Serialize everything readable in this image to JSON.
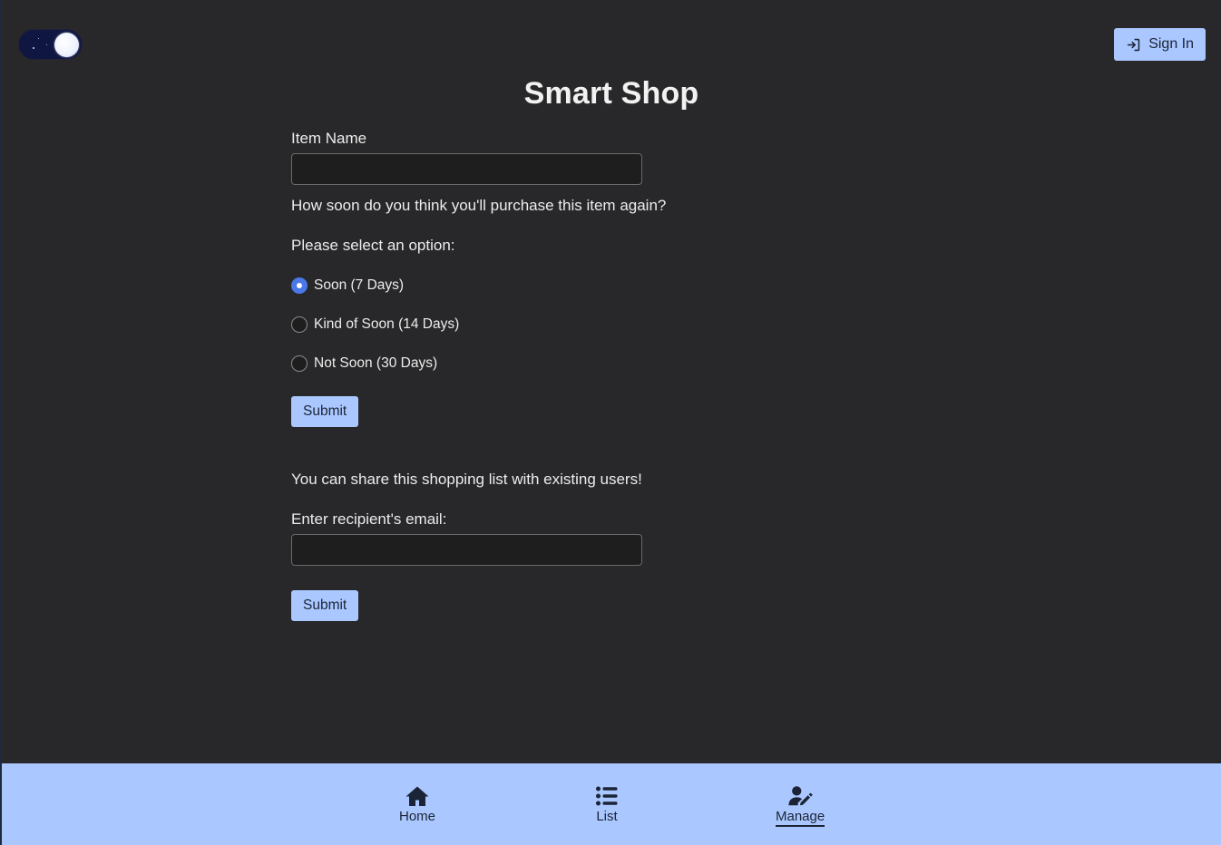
{
  "header": {
    "theme_toggle_icon": "moon-icon",
    "sign_in_label": "Sign In",
    "sign_in_icon": "sign-in-icon"
  },
  "page_title": "Smart Shop",
  "add_item_form": {
    "item_name_label": "Item Name",
    "item_name_value": "",
    "question": "How soon do you think you'll purchase this item again?",
    "options_legend": "Please select an option:",
    "options": [
      {
        "label": "Soon (7 Days)",
        "checked": true
      },
      {
        "label": "Kind of Soon (14 Days)",
        "checked": false
      },
      {
        "label": "Not Soon (30 Days)",
        "checked": false
      }
    ],
    "submit_label": "Submit"
  },
  "share_form": {
    "info": "You can share this shopping list with existing users!",
    "email_label": "Enter recipient's email:",
    "email_value": "",
    "submit_label": "Submit"
  },
  "nav": {
    "items": [
      {
        "label": "Home",
        "icon": "home-icon",
        "active": false
      },
      {
        "label": "List",
        "icon": "list-icon",
        "active": false
      },
      {
        "label": "Manage",
        "icon": "user-edit-icon",
        "active": true
      }
    ]
  },
  "colors": {
    "background": "#28282a",
    "accent": "#aac8ff",
    "radio_checked": "#4a78e6"
  }
}
